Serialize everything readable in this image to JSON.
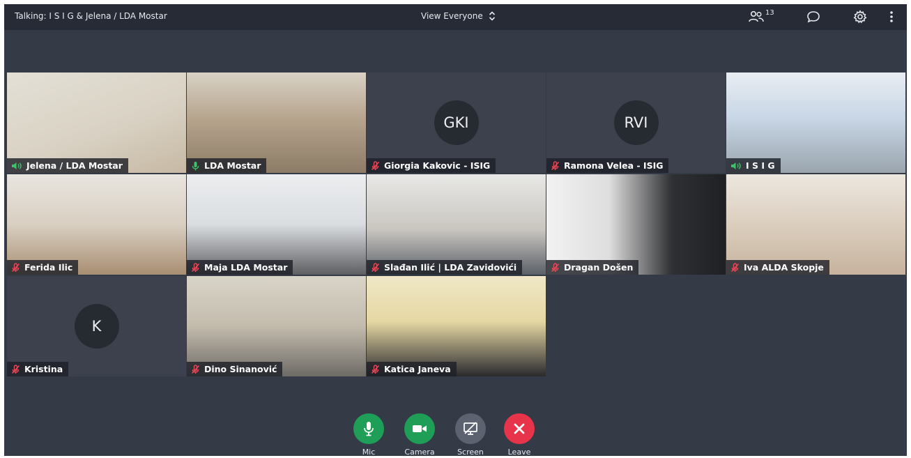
{
  "topbar": {
    "talking": "Talking: I S I G  & Jelena / LDA Mostar",
    "view_label": "View Everyone",
    "participants_count": "13",
    "icons": [
      "participants-icon",
      "chat-icon",
      "settings-icon",
      "more-icon"
    ]
  },
  "tiles": [
    {
      "name": "Jelena / LDA Mostar",
      "status": "speaking",
      "video": true
    },
    {
      "name": "LDA Mostar",
      "status": "mic-on",
      "video": true
    },
    {
      "name": "Giorgia Kakovic - ISIG",
      "status": "muted",
      "video": false,
      "initials": "GKI"
    },
    {
      "name": "Ramona Velea - ISIG",
      "status": "muted",
      "video": false,
      "initials": "RVI"
    },
    {
      "name": "I S I G",
      "status": "speaking",
      "video": true
    },
    {
      "name": "Ferida Ilic",
      "status": "muted",
      "video": true
    },
    {
      "name": "Maja LDA Mostar",
      "status": "muted",
      "video": true
    },
    {
      "name": "Slađan Ilić | LDA Zavidovići",
      "status": "muted",
      "video": true
    },
    {
      "name": "Dragan Došen",
      "status": "muted",
      "video": true
    },
    {
      "name": "Iva ALDA Skopje",
      "status": "muted",
      "video": true
    },
    {
      "name": "Kristina",
      "status": "muted",
      "video": false,
      "initials": "K"
    },
    {
      "name": "Dino Sinanović",
      "status": "muted",
      "video": true
    },
    {
      "name": "Katica Janeva",
      "status": "muted",
      "video": true
    }
  ],
  "controls": {
    "mic": "Mic",
    "camera": "Camera",
    "screen": "Screen",
    "leave": "Leave"
  },
  "colors": {
    "mic": "#1e9e57",
    "camera": "#1e9e57",
    "screen": "#5c6270",
    "leave": "#e8344a",
    "muted": "#e74a5a",
    "speaking": "#3fc36a"
  }
}
